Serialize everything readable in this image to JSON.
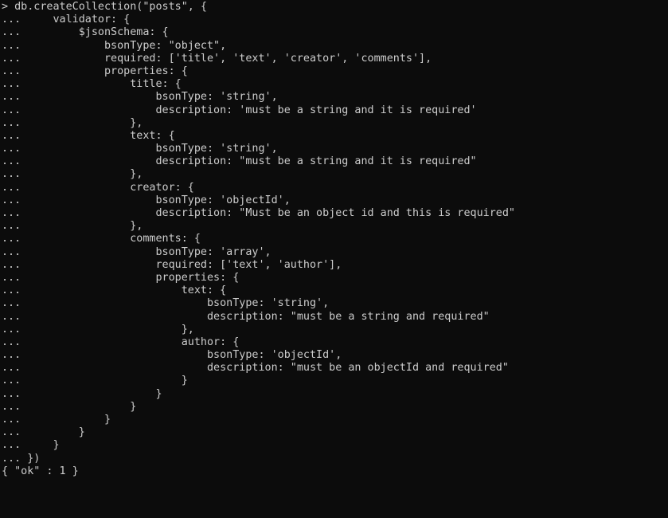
{
  "terminal": {
    "lines": [
      "> db.createCollection(\"posts\", {",
      "...     validator: {",
      "...         $jsonSchema: {",
      "...             bsonType: \"object\",",
      "...             required: ['title', 'text', 'creator', 'comments'],",
      "...             properties: {",
      "...                 title: {",
      "...                     bsonType: 'string',",
      "...                     description: 'must be a string and it is required'",
      "...                 },",
      "...                 text: {",
      "...                     bsonType: 'string',",
      "...                     description: \"must be a string and it is required\"",
      "...                 },",
      "...                 creator: {",
      "...                     bsonType: 'objectId',",
      "...                     description: \"Must be an object id and this is required\"",
      "...                 },",
      "...                 comments: {",
      "...                     bsonType: 'array',",
      "...                     required: ['text', 'author'],",
      "...                     properties: {",
      "...                         text: {",
      "...                             bsonType: 'string',",
      "...                             description: \"must be a string and required\"",
      "...                         },",
      "...                         author: {",
      "...                             bsonType: 'objectId',",
      "...                             description: \"must be an objectId and required\"",
      "...                         }",
      "...                     }",
      "...                 }",
      "...             }",
      "...         }",
      "...     }",
      "... })",
      "{ \"ok\" : 1 }"
    ]
  }
}
